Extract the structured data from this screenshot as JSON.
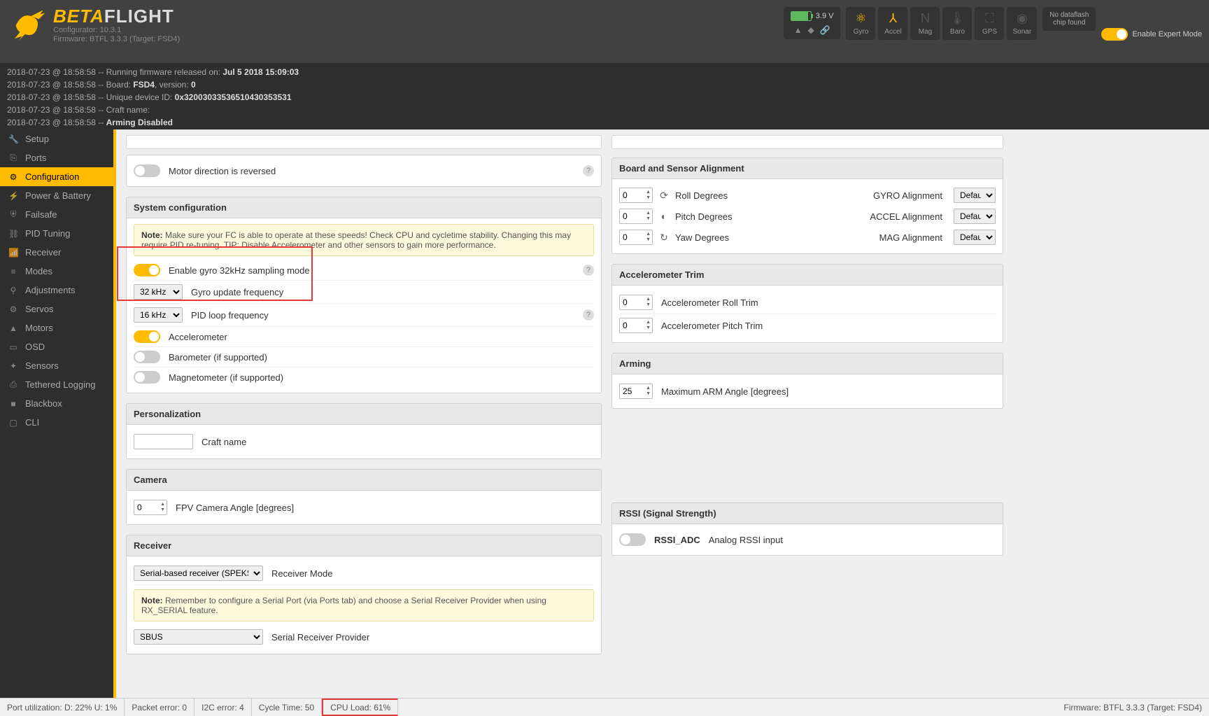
{
  "app": {
    "brand_beta": "BETA",
    "brand_flight": "FLIGHT",
    "configurator": "Configurator: 10.3.1",
    "firmware": "Firmware: BTFL 3.3.3 (Target: FSD4)"
  },
  "header": {
    "voltage": "3.9 V",
    "sensors": [
      {
        "key": "gyro",
        "label": "Gyro",
        "active": true,
        "glyph": "⚛"
      },
      {
        "key": "accel",
        "label": "Accel",
        "active": true,
        "glyph": "⅄"
      },
      {
        "key": "mag",
        "label": "Mag",
        "active": false,
        "glyph": "N"
      },
      {
        "key": "baro",
        "label": "Baro",
        "active": false,
        "glyph": "🌡"
      },
      {
        "key": "gps",
        "label": "GPS",
        "active": false,
        "glyph": "⛶"
      },
      {
        "key": "sonar",
        "label": "Sonar",
        "active": false,
        "glyph": "◉"
      }
    ],
    "dataflash_l1": "No dataflash",
    "dataflash_l2": "chip found",
    "expert_label": "Enable Expert Mode"
  },
  "log": [
    {
      "ts": "2018-07-23 @ 18:58:58",
      "msg": "Running firmware released on:",
      "bold": "Jul 5 2018 15:09:03"
    },
    {
      "ts": "2018-07-23 @ 18:58:58",
      "msg": "Board:",
      "bold": "FSD4",
      "tail": ", version:",
      "bold2": "0"
    },
    {
      "ts": "2018-07-23 @ 18:58:58",
      "msg": "Unique device ID:",
      "bold": "0x32003033536510430353531"
    },
    {
      "ts": "2018-07-23 @ 18:58:58",
      "msg": "Craft name:",
      "bold": ""
    },
    {
      "ts": "2018-07-23 @ 18:58:58",
      "msg": "",
      "bold": "Arming Disabled"
    }
  ],
  "nav": [
    {
      "icon": "🔧",
      "label": "Setup"
    },
    {
      "icon": "⎘",
      "label": "Ports"
    },
    {
      "icon": "⚙",
      "label": "Configuration",
      "active": true
    },
    {
      "icon": "⚡",
      "label": "Power & Battery"
    },
    {
      "icon": "⛨",
      "label": "Failsafe"
    },
    {
      "icon": "⛓",
      "label": "PID Tuning"
    },
    {
      "icon": "📶",
      "label": "Receiver"
    },
    {
      "icon": "≡",
      "label": "Modes"
    },
    {
      "icon": "⚲",
      "label": "Adjustments"
    },
    {
      "icon": "⚙",
      "label": "Servos"
    },
    {
      "icon": "▲",
      "label": "Motors"
    },
    {
      "icon": "▭",
      "label": "OSD"
    },
    {
      "icon": "✦",
      "label": "Sensors"
    },
    {
      "icon": "⎙",
      "label": "Tethered Logging"
    },
    {
      "icon": "■",
      "label": "Blackbox"
    },
    {
      "icon": "▢",
      "label": "CLI"
    }
  ],
  "left": {
    "motor_reversed": "Motor direction is reversed",
    "sys_config_title": "System configuration",
    "note_label": "Note:",
    "note_text": "Make sure your FC is able to operate at these speeds! Check CPU and cycletime stability. Changing this may require PID re-tuning. TIP: Disable Accelerometer and other sensors to gain more performance.",
    "gyro32_label": "Enable gyro 32kHz sampling mode",
    "gyro_freq_val": "32 kHz",
    "gyro_freq_label": "Gyro update frequency",
    "pid_freq_val": "16 kHz",
    "pid_freq_label": "PID loop frequency",
    "accel_label": "Accelerometer",
    "baro_label": "Barometer (if supported)",
    "mag_label": "Magnetometer (if supported)",
    "personalization_title": "Personalization",
    "craft_name_label": "Craft name",
    "camera_title": "Camera",
    "fpv_angle_val": 0,
    "fpv_angle_label": "FPV Camera Angle [degrees]",
    "receiver_title": "Receiver",
    "recv_mode_val": "Serial-based receiver (SPEKSAT, SBUS, SUMD)",
    "recv_mode_label": "Receiver Mode",
    "recv_note_label": "Note:",
    "recv_note_text": "Remember to configure a Serial Port (via Ports tab) and choose a Serial Receiver Provider when using RX_SERIAL feature.",
    "provider_val": "SBUS",
    "provider_label": "Serial Receiver Provider"
  },
  "right": {
    "board_align_title": "Board and Sensor Alignment",
    "roll_val": 0,
    "roll_label": "Roll Degrees",
    "pitch_val": 0,
    "pitch_label": "Pitch Degrees",
    "yaw_val": 0,
    "yaw_label": "Yaw Degrees",
    "gyro_align_label": "GYRO Alignment",
    "gyro_align_val": "Default",
    "accel_align_label": "ACCEL Alignment",
    "accel_align_val": "Default",
    "mag_align_label": "MAG Alignment",
    "mag_align_val": "Default",
    "accel_trim_title": "Accelerometer Trim",
    "trim_roll_val": 0,
    "trim_roll_label": "Accelerometer Roll Trim",
    "trim_pitch_val": 0,
    "trim_pitch_label": "Accelerometer Pitch Trim",
    "arming_title": "Arming",
    "arm_val": 25,
    "arm_label": "Maximum ARM Angle [degrees]",
    "rssi_title": "RSSI (Signal Strength)",
    "rssi_adc_bold": "RSSI_ADC",
    "rssi_adc_label": "Analog RSSI input"
  },
  "status": {
    "port_util": "Port utilization: D: 22% U: 1%",
    "packet_err": "Packet error: 0",
    "i2c_err": "I2C error: 4",
    "cycle_time": "Cycle Time: 50",
    "cpu_load": "CPU Load: 61%",
    "firmware": "Firmware: BTFL 3.3.3 (Target: FSD4)"
  }
}
